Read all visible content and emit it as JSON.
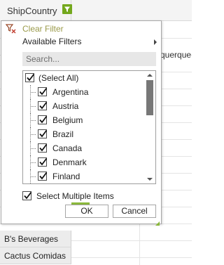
{
  "grid": {
    "column_header": "ShipCountry",
    "visible_cell_text": "querque",
    "rows": [
      "B's Beverages",
      "Cactus Comidas"
    ]
  },
  "filter_popup": {
    "clear_filter": "Clear Filter",
    "available_filters": "Available Filters",
    "search_placeholder": "Search...",
    "items": [
      {
        "label": "(Select All)",
        "checked": true
      },
      {
        "label": "Argentina",
        "checked": true
      },
      {
        "label": "Austria",
        "checked": true
      },
      {
        "label": "Belgium",
        "checked": true
      },
      {
        "label": "Brazil",
        "checked": true
      },
      {
        "label": "Canada",
        "checked": true
      },
      {
        "label": "Denmark",
        "checked": true
      },
      {
        "label": "Finland",
        "checked": true
      }
    ],
    "select_multiple": "Select Multiple Items",
    "select_multiple_checked": true,
    "ok": "OK",
    "cancel": "Cancel"
  },
  "icons": {
    "column_filter": "funnel-icon",
    "clear_filter": "funnel-clear-icon",
    "submenu": "chevron-right-icon",
    "check": "checkmark-icon"
  },
  "colors": {
    "accent_green": "#74a81d",
    "clear_filter_text": "#9a9a4a",
    "scroll_thumb": "#777777"
  }
}
